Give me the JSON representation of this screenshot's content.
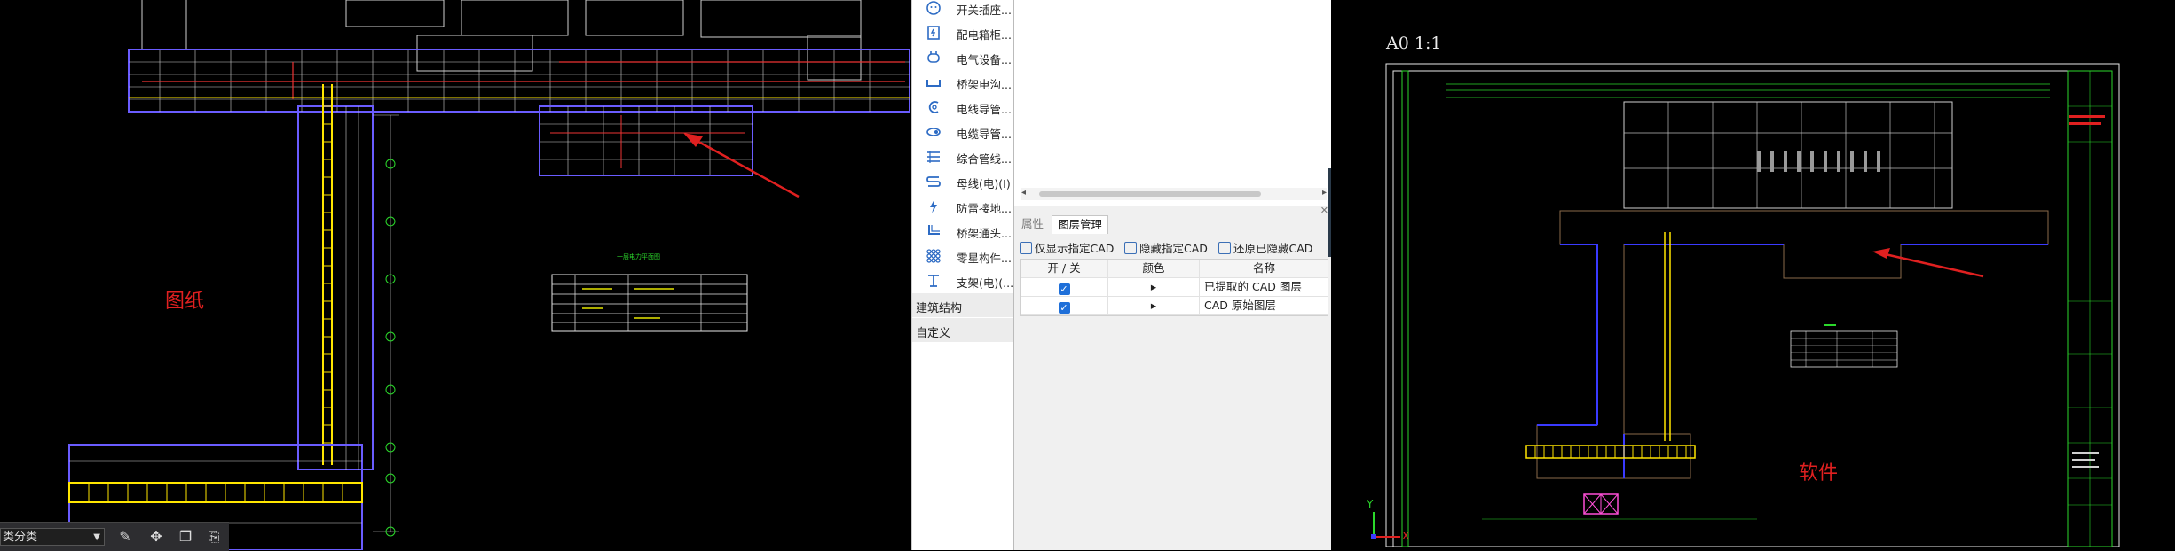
{
  "left_view": {
    "label": "图纸",
    "annotation_color": "#e02020"
  },
  "bottom_toolbar": {
    "classify_value": "类分类"
  },
  "tree": {
    "items": [
      {
        "label": "开关插座...",
        "icon": "switch-socket-icon"
      },
      {
        "label": "配电箱柜...",
        "icon": "distribution-box-icon"
      },
      {
        "label": "电气设备...",
        "icon": "electrical-equipment-icon"
      },
      {
        "label": "桥架电沟...",
        "icon": "cable-tray-icon"
      },
      {
        "label": "电线导管...",
        "icon": "wire-conduit-icon"
      },
      {
        "label": "电缆导管...",
        "icon": "cable-conduit-icon"
      },
      {
        "label": "综合管线...",
        "icon": "pipeline-icon"
      },
      {
        "label": "母线(电)(I)",
        "icon": "busbar-icon"
      },
      {
        "label": "防雷接地...",
        "icon": "lightning-ground-icon"
      },
      {
        "label": "桥架通头...",
        "icon": "tray-fitting-icon"
      },
      {
        "label": "零星构件...",
        "icon": "misc-component-icon"
      },
      {
        "label": "支架(电)(...",
        "icon": "bracket-icon"
      }
    ],
    "categories": [
      "建筑结构",
      "自定义"
    ]
  },
  "layer_panel": {
    "tabs": [
      "属性",
      "图层管理"
    ],
    "active_tab": "图层管理",
    "actions": [
      "仅显示指定CAD",
      "隐藏指定CAD",
      "还原已隐藏CAD"
    ],
    "columns": [
      "开 / 关",
      "颜色",
      "名称"
    ],
    "rows": [
      {
        "checked": true,
        "color": "▸",
        "name": "已提取的 CAD 图层"
      },
      {
        "checked": true,
        "color": "▸",
        "name": "CAD 原始图层"
      }
    ]
  },
  "right_view": {
    "sheet_label": "A0  1:1",
    "label": "软件",
    "axis_x": "X",
    "axis_y": "Y"
  }
}
